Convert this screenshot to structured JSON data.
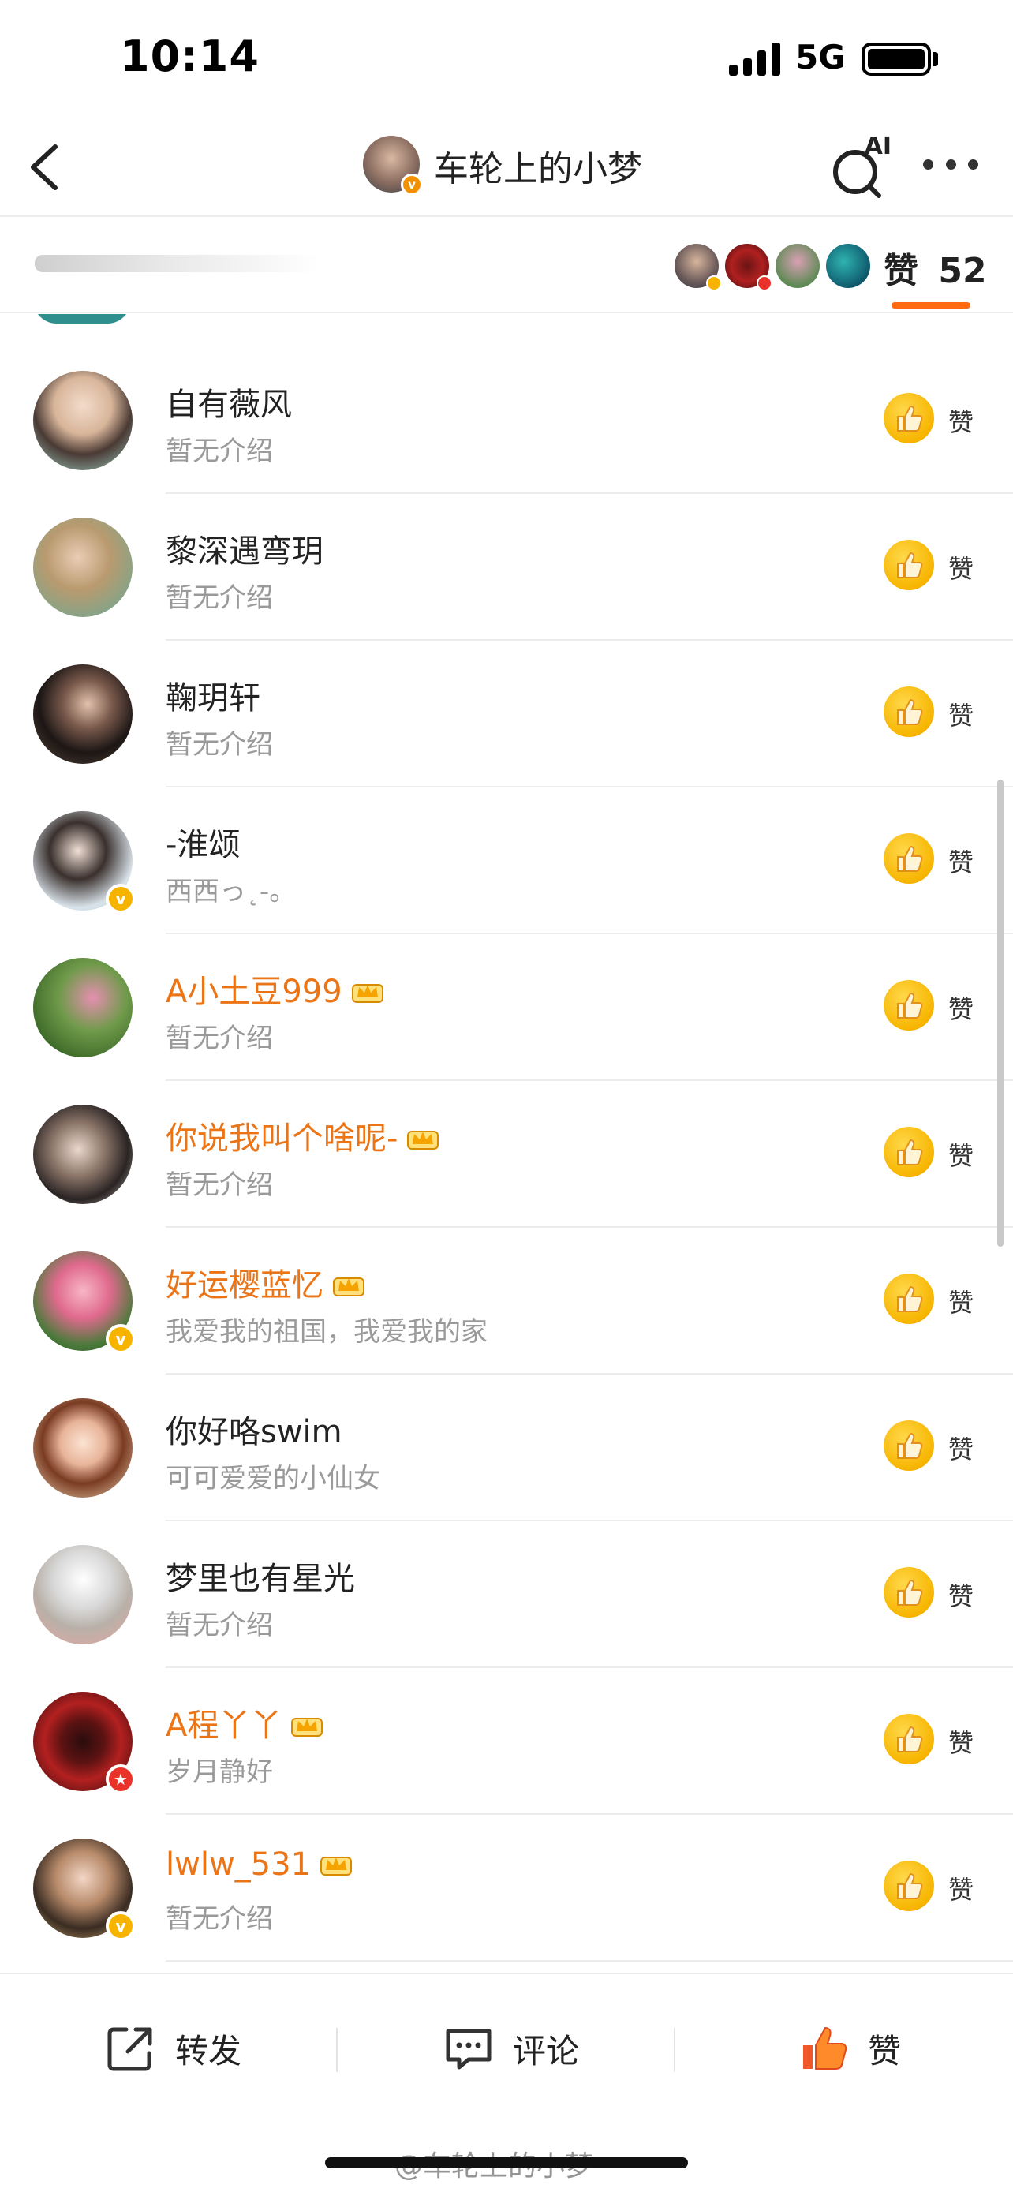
{
  "status_bar": {
    "time": "10:14",
    "network": "5G"
  },
  "header": {
    "title": "车轮上的小梦",
    "ai_label": "AI"
  },
  "tabs": {
    "likes_label": "赞",
    "likes_count": "52"
  },
  "like_label": "赞",
  "list": [
    {
      "name": "自有薇风",
      "intro": "暂无介绍",
      "vip": false,
      "badge": ""
    },
    {
      "name": "黎深遇弯玥",
      "intro": "暂无介绍",
      "vip": false,
      "badge": ""
    },
    {
      "name": "鞠玥轩",
      "intro": "暂无介绍",
      "vip": false,
      "badge": ""
    },
    {
      "name": "-淮颂",
      "intro": "西西っ˛-。",
      "vip": false,
      "badge": "gold"
    },
    {
      "name": "A小土豆999",
      "intro": "暂无介绍",
      "vip": true,
      "badge": ""
    },
    {
      "name": "你说我叫个啥呢-",
      "intro": "暂无介绍",
      "vip": true,
      "badge": ""
    },
    {
      "name": "好运樱蓝忆",
      "intro": "我爱我的祖国，我爱我的家",
      "vip": true,
      "badge": "gold"
    },
    {
      "name": "你好咯swim",
      "intro": "可可爱爱的小仙女",
      "vip": false,
      "badge": ""
    },
    {
      "name": "梦里也有星光",
      "intro": "暂无介绍",
      "vip": false,
      "badge": ""
    },
    {
      "name": "A程丫丫",
      "intro": "岁月静好",
      "vip": true,
      "badge": "red"
    },
    {
      "name": "lwlw_531",
      "intro": "暂无介绍",
      "vip": true,
      "badge": "gold"
    }
  ],
  "bottom_bar": {
    "repost": "转发",
    "comment": "评论",
    "like": "赞"
  },
  "watermark": "@车轮上的小梦",
  "colors": {
    "accent": "#ff6a13",
    "vip_name": "#eb7416",
    "like_yellow": "#f7b500",
    "intro_gray": "#9a9a9a"
  }
}
